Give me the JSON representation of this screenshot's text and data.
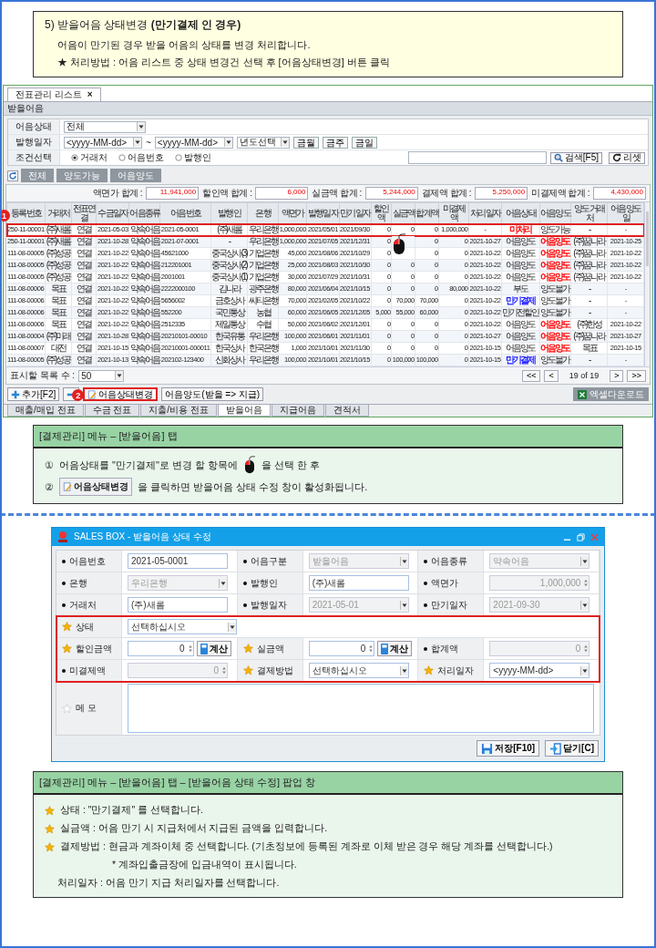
{
  "intro": {
    "title": "5) 받을어음 상태변경 **(만기결제 인 경우)**",
    "lines": [
      "어음이 만기된 경우 받을 어음의 상태를 변경 처리합니다.",
      "★ 처리방법 : 어음 리스트 중 상태 변경건 선택 후 [어음상태변경] 버튼 클릭"
    ]
  },
  "list_window": {
    "tab": {
      "label": "전표관리 리스트",
      "close": "×"
    },
    "section_title": "받을어음",
    "filters": {
      "status": {
        "label": "어음상태",
        "value": "전체"
      },
      "issue_date": {
        "label": "발행일자",
        "from": "<yyyy-MM-dd>",
        "separator": "~",
        "to": "<yyyy-MM-dd>",
        "year": "년도선택",
        "quick": [
          "금월",
          "금주",
          "금일"
        ]
      },
      "condition": {
        "label": "조건선택",
        "options": [
          {
            "label": "거래처",
            "selected": true
          },
          {
            "label": "어음번호",
            "selected": false
          },
          {
            "label": "발행인",
            "selected": false
          }
        ]
      },
      "search_button": "검색[F5]",
      "reset_button": "리셋"
    },
    "view_buttons": [
      "전체",
      "양도가능",
      "어음양도"
    ],
    "totals": [
      {
        "label": "액면가 합계 :",
        "value": "11,941,000"
      },
      {
        "label": "할인액 합계 :",
        "value": "6,000"
      },
      {
        "label": "실금액 합계 :",
        "value": "5,244,000"
      },
      {
        "label": "결제액 합계 :",
        "value": "5,250,000"
      },
      {
        "label": "미결제액 합계 :",
        "value": "4,430,000"
      }
    ],
    "columns": [
      {
        "label": "등록번호",
        "kind": "code"
      },
      {
        "label": "거래처",
        "kind": "text"
      },
      {
        "label": "전표연결",
        "kind": "text"
      },
      {
        "label": "수금일자",
        "kind": "date"
      },
      {
        "label": "어음종류",
        "kind": "text"
      },
      {
        "label": "어음번호",
        "kind": "code"
      },
      {
        "label": "발행인",
        "kind": "text"
      },
      {
        "label": "은행",
        "kind": "text"
      },
      {
        "label": "액면가",
        "kind": "amount"
      },
      {
        "label": "발행일자",
        "kind": "date"
      },
      {
        "label": "만기일자",
        "kind": "date"
      },
      {
        "label": "할인액",
        "kind": "amount"
      },
      {
        "label": "실금액",
        "kind": "amount"
      },
      {
        "label": "합계액",
        "kind": "amount"
      },
      {
        "label": "미결제액",
        "kind": "amount"
      },
      {
        "label": "처리일자",
        "kind": "date"
      },
      {
        "label": "어음상태",
        "kind": "text"
      },
      {
        "label": "어음양도",
        "kind": "text"
      },
      {
        "label": "양도 거래처",
        "kind": "text"
      },
      {
        "label": "어음양도일",
        "kind": "date"
      }
    ],
    "rows": [
      {
        "selected": true,
        "cells": [
          "250-11-00001",
          "(주)새롬",
          "연결",
          "2021-05-03",
          "약속어음",
          "2021-05-0001",
          "(주)새롬",
          "우리은행",
          "1,000,000",
          "2021/05/01",
          "2021/09/30",
          "0",
          "0",
          "0",
          "1,000,000",
          "-",
          {
            "text": "미처리",
            "color": "#ff0000"
          },
          "양도가능",
          "-",
          "-"
        ]
      },
      {
        "selected": false,
        "cells": [
          "250-11-00001",
          "(주)새롬",
          "연결",
          "2021-10-28",
          "약속어음",
          "2021-07-0001",
          "-",
          "우리은행",
          "1,000,000",
          "2021/07/05",
          "2021/12/31",
          "0",
          null,
          "0",
          "0",
          "2021-10-27",
          "어음양도",
          {
            "text": "어음양도",
            "color": "#ff0000"
          },
          "(주)꿈나라",
          "2021-10-25"
        ]
      },
      {
        "selected": false,
        "cells": [
          "111-08-00005",
          "(주)성공",
          "연결",
          "2021-10-22",
          "약속어음",
          "45621000",
          "중국상사(3)",
          "기업은행",
          "45,000",
          "2021/08/06",
          "2021/10/29",
          "0",
          null,
          "0",
          "0",
          "2021-10-22",
          "어음양도",
          {
            "text": "어음양도",
            "color": "#ff0000"
          },
          "(주)꿈나라",
          "2021-10-22"
        ]
      },
      {
        "selected": false,
        "cells": [
          "111-08-00005",
          "(주)성공",
          "연결",
          "2021-10-22",
          "약속어음",
          "212201001",
          "중국상사(2)",
          "기업은행",
          "25,000",
          "2021/08/03",
          "2021/10/30",
          "0",
          "0",
          "0",
          "0",
          "2021-10-22",
          "어음양도",
          {
            "text": "어음양도",
            "color": "#ff0000"
          },
          "(주)꿈나라",
          "2021-10-22"
        ]
      },
      {
        "selected": false,
        "cells": [
          "111-08-00005",
          "(주)성공",
          "연결",
          "2021-10-22",
          "약속어음",
          "2001001",
          "중국상사(1)",
          "기업은행",
          "30,000",
          "2021/07/29",
          "2021/10/31",
          "0",
          "0",
          "0",
          "0",
          "2021-10-22",
          "어음양도",
          {
            "text": "어음양도",
            "color": "#ff0000"
          },
          "(주)꿈나라",
          "2021-10-22"
        ]
      },
      {
        "selected": false,
        "cells": [
          "111-08-00006",
          "목표",
          "연결",
          "2021-10-22",
          "약속어음",
          "2222000100",
          "김나라",
          "광주은행",
          "80,000",
          "2021/06/04",
          "2021/10/15",
          "0",
          "0",
          "0",
          "80,000",
          "2021-10-22",
          "부도",
          "양도불가",
          "-",
          "-"
        ]
      },
      {
        "selected": false,
        "cells": [
          "111-08-00006",
          "목표",
          "연결",
          "2021-10-22",
          "약속어음",
          "5656002",
          "금호상사",
          "씨티은행",
          "70,000",
          "2021/02/05",
          "2021/10/22",
          "0",
          "70,000",
          "70,000",
          "0",
          "2021-10-22",
          {
            "text": "만기결제",
            "color": "#1a1aff"
          },
          "양도불가",
          "-",
          "-"
        ]
      },
      {
        "selected": false,
        "cells": [
          "111-08-00006",
          "목표",
          "연결",
          "2021-10-22",
          "약속어음",
          "552200",
          "국민통상",
          "농협",
          "60,000",
          "2021/06/05",
          "2021/12/05",
          "5,000",
          "55,000",
          "60,000",
          "0",
          "2021-10-22",
          "만기전할인",
          "양도불가",
          "-",
          "-"
        ]
      },
      {
        "selected": false,
        "cells": [
          "111-08-00006",
          "목표",
          "연결",
          "2021-10-22",
          "약속어음",
          "2512335",
          "제일통상",
          "수협",
          "50,000",
          "2021/06/02",
          "2021/12/01",
          "0",
          "0",
          "0",
          "0",
          "2021-10-22",
          "어음양도",
          {
            "text": "어음양도",
            "color": "#ff0000"
          },
          "(주)한성",
          "2021-10-22"
        ]
      },
      {
        "selected": false,
        "cells": [
          "111-08-00004",
          "(주)미래",
          "연결",
          "2021-10-28",
          "약속어음",
          "20210101-00010",
          "한국유통",
          "우리은행",
          "100,000",
          "2021/06/01",
          "2021/11/01",
          "0",
          "0",
          "0",
          "0",
          "2021-10-27",
          "어음양도",
          {
            "text": "어음양도",
            "color": "#ff0000"
          },
          "(주)꿈나라",
          "2021-10-27"
        ]
      },
      {
        "selected": false,
        "cells": [
          "111-08-00007",
          "대전",
          "연결",
          "2021-10-15",
          "약속어음",
          "20210001-000011",
          "한국상사",
          "한국은행",
          "1,000",
          "2021/10/01",
          "2021/11/30",
          "0",
          "0",
          "0",
          "0",
          "2021-10-15",
          "어음양도",
          {
            "text": "어음양도",
            "color": "#ff0000"
          },
          "목표",
          "2021-10-15"
        ]
      },
      {
        "selected": false,
        "cells": [
          "111-08-00005",
          "(주)성공",
          "연결",
          "2021-10-13",
          "약속어음",
          "202102-123400",
          "신화상사",
          "우리은행",
          "100,000",
          "2021/10/01",
          "2021/10/15",
          "0",
          "100,000",
          "100,000",
          "0",
          "2021-10-15",
          {
            "text": "만기결제",
            "color": "#1a1aff"
          },
          "양도불가",
          "-",
          "-"
        ]
      }
    ],
    "badge": "1",
    "page_size": {
      "label": "표시할 목록 수 :",
      "value": "50"
    },
    "pagination": {
      "first": "<<",
      "prev": "<",
      "info": "19 of 19",
      "next": ">",
      "last": ">>"
    },
    "actions": [
      {
        "kind": "add",
        "label": "추가[F2]",
        "highlighted": false
      },
      {
        "kind": "remove",
        "highlighted": false
      },
      {
        "kind": "edit",
        "label": "어음상태변경",
        "highlighted": true,
        "badge": "2"
      },
      {
        "kind": "plain",
        "label": "어음양도(받을 => 지급)",
        "highlighted": false
      }
    ],
    "excel_button": "엑셀다운로드",
    "bottom_tabs": [
      {
        "label": "매출/매입 전표",
        "selected": false
      },
      {
        "label": "수금 전표",
        "selected": false
      },
      {
        "label": "지출/비용 전표",
        "selected": false
      },
      {
        "label": "받을어음",
        "selected": true
      },
      {
        "label": "지급어음",
        "selected": false
      },
      {
        "label": "견적서",
        "selected": false
      }
    ]
  },
  "guide": {
    "title": "[결제관리] 메뉴 – [받을어음] 탭",
    "steps": [
      {
        "number": "①",
        "kind": "mouse",
        "before": "어음상태를 \"만기결제\"로 변경 할 항목에",
        "after": "을 선택 한 후"
      },
      {
        "number": "②",
        "kind": "button",
        "button": "어음상태변경",
        "after": "을 클릭하면 받을어음 상태 수정 창이 활성화됩니다."
      }
    ]
  },
  "dialog": {
    "title": "SALES BOX - 받을어음 상태 수정",
    "info_rows": [
      [
        {
          "label": "어음번호",
          "required": false,
          "kind": "text",
          "value": "2021-05-0001",
          "disabled": false
        },
        {
          "label": "어음구분",
          "required": false,
          "kind": "select",
          "value": "받을어음",
          "disabled": true
        },
        {
          "label": "어음종류",
          "required": false,
          "kind": "select",
          "value": "약속어음",
          "disabled": true
        }
      ],
      [
        {
          "label": "은행",
          "required": false,
          "kind": "select",
          "value": "우리은행",
          "disabled": true
        },
        {
          "label": "발행인",
          "required": false,
          "kind": "text",
          "value": "(주)새롬",
          "disabled": false
        },
        {
          "label": "액면가",
          "required": false,
          "kind": "number",
          "value": "1,000,000",
          "disabled": true
        }
      ],
      [
        {
          "label": "거래처",
          "required": false,
          "kind": "text",
          "value": "(주)새롬",
          "disabled": false
        },
        {
          "label": "발행일자",
          "required": false,
          "kind": "select",
          "value": "2021-05-01",
          "disabled": true
        },
        {
          "label": "만기일자",
          "required": false,
          "kind": "select",
          "value": "2021-09-30",
          "disabled": true
        }
      ]
    ],
    "edit_rows": [
      [
        {
          "label": "상태",
          "required": true,
          "kind": "select",
          "value": "선택하십시오",
          "disabled": false
        }
      ],
      [
        {
          "label": "할인금액",
          "required": true,
          "kind": "number",
          "value": "0",
          "disabled": false,
          "calc_button": "계산"
        },
        {
          "label": "실금액",
          "required": true,
          "kind": "number",
          "value": "0",
          "disabled": false,
          "calc_button": "계산"
        },
        {
          "label": "합계액",
          "required": false,
          "kind": "number",
          "value": "0",
          "disabled": true
        }
      ],
      [
        {
          "label": "미결제액",
          "required": false,
          "kind": "number",
          "value": "0",
          "disabled": true
        },
        {
          "label": "결제방법",
          "required": true,
          "kind": "select",
          "value": "선택하십시오",
          "disabled": false
        },
        {
          "label": "처리일자",
          "required": true,
          "kind": "select",
          "value": "<yyyy-MM-dd>",
          "disabled": false
        }
      ]
    ],
    "memo": {
      "label": "메 모"
    },
    "buttons": [
      {
        "kind": "save",
        "label": "저장[F10]"
      },
      {
        "kind": "close",
        "label": "닫기[C]"
      }
    ]
  },
  "notes": {
    "title": "[결제관리] 메뉴 – [받을어음] 탭 – [받을어음 상태 수정] 팝업 창",
    "lines": [
      {
        "kind": "star",
        "text": "상태 :  \"만기결제\" 를 선택합니다."
      },
      {
        "kind": "star",
        "text": "실금액 : 어음 만기 시 지급처에서 지급된 금액을 입력합니다."
      },
      {
        "kind": "star",
        "text": "결제방법 : 현금과 계좌이체 중 선택합니다. (기초정보에 등록된 계좌로 이체 받은 경우 해당 계좌를 선택합니다.)"
      },
      {
        "kind": "note",
        "text": "* 계좌입출금장에 입금내역이 표시됩니다."
      },
      {
        "kind": "plain",
        "text": "처리일자 : 어음 만기 지급 처리일자를 선택합니다."
      }
    ]
  }
}
